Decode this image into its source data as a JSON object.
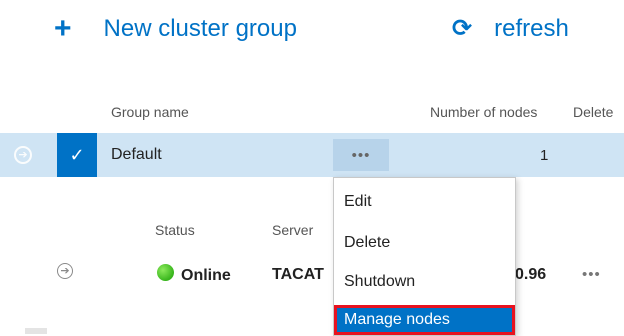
{
  "toolbar": {
    "new_group": {
      "icon_name": "plus-icon",
      "icon": "+",
      "label": "New cluster group"
    },
    "refresh": {
      "icon_name": "refresh-icon",
      "icon": "⟳",
      "label": "refresh"
    }
  },
  "group_grid": {
    "columns": [
      "Group name",
      "Number of nodes",
      "Delete"
    ],
    "rows": [
      {
        "name": "Default",
        "selected": true,
        "actions": "•••",
        "node_count": "1"
      }
    ]
  },
  "node_grid": {
    "columns": [
      "Status",
      "Server"
    ],
    "rows": [
      {
        "status": "Online",
        "status_color": "#3cb81f",
        "server": "TACAT",
        "version_partial": "0.96",
        "actions": "•••"
      }
    ]
  },
  "context_menu": {
    "items": [
      "Edit",
      "Delete",
      "Shutdown",
      "Manage nodes"
    ],
    "highlighted_index": 3
  },
  "colors": {
    "accent": "#0072c6",
    "selected_row": "#cfe4f4",
    "highlight_border": "#e8121f"
  }
}
